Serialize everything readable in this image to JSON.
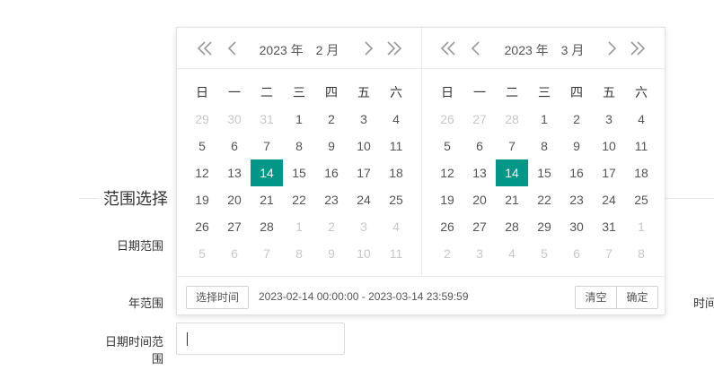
{
  "section_title": "范围选择",
  "labels": {
    "date_range": "日期范围",
    "year_range": "年范围",
    "datetime_range_line1": "日期时间范",
    "datetime_range_line2": "围",
    "side_label": "时间"
  },
  "input": {
    "value": ""
  },
  "weekdays": [
    "日",
    "一",
    "二",
    "三",
    "四",
    "五",
    "六"
  ],
  "left_calendar": {
    "year": "2023 年",
    "month": "2 月",
    "selected": 14,
    "days": [
      [
        [
          "29",
          1
        ],
        [
          "30",
          1
        ],
        [
          "31",
          1
        ],
        [
          "1",
          0
        ],
        [
          "2",
          0
        ],
        [
          "3",
          0
        ],
        [
          "4",
          0
        ]
      ],
      [
        [
          "5",
          0
        ],
        [
          "6",
          0
        ],
        [
          "7",
          0
        ],
        [
          "8",
          0
        ],
        [
          "9",
          0
        ],
        [
          "10",
          0
        ],
        [
          "11",
          0
        ]
      ],
      [
        [
          "12",
          0
        ],
        [
          "13",
          0
        ],
        [
          "14",
          0
        ],
        [
          "15",
          0
        ],
        [
          "16",
          0
        ],
        [
          "17",
          0
        ],
        [
          "18",
          0
        ]
      ],
      [
        [
          "19",
          0
        ],
        [
          "20",
          0
        ],
        [
          "21",
          0
        ],
        [
          "22",
          0
        ],
        [
          "23",
          0
        ],
        [
          "24",
          0
        ],
        [
          "25",
          0
        ]
      ],
      [
        [
          "26",
          0
        ],
        [
          "27",
          0
        ],
        [
          "28",
          0
        ],
        [
          "1",
          1
        ],
        [
          "2",
          1
        ],
        [
          "3",
          1
        ],
        [
          "4",
          1
        ]
      ],
      [
        [
          "5",
          1
        ],
        [
          "6",
          1
        ],
        [
          "7",
          1
        ],
        [
          "8",
          1
        ],
        [
          "9",
          1
        ],
        [
          "10",
          1
        ],
        [
          "11",
          1
        ]
      ]
    ]
  },
  "right_calendar": {
    "year": "2023 年",
    "month": "3 月",
    "selected": 14,
    "days": [
      [
        [
          "26",
          1
        ],
        [
          "27",
          1
        ],
        [
          "28",
          1
        ],
        [
          "1",
          0
        ],
        [
          "2",
          0
        ],
        [
          "3",
          0
        ],
        [
          "4",
          0
        ]
      ],
      [
        [
          "5",
          0
        ],
        [
          "6",
          0
        ],
        [
          "7",
          0
        ],
        [
          "8",
          0
        ],
        [
          "9",
          0
        ],
        [
          "10",
          0
        ],
        [
          "11",
          0
        ]
      ],
      [
        [
          "12",
          0
        ],
        [
          "13",
          0
        ],
        [
          "14",
          0
        ],
        [
          "15",
          0
        ],
        [
          "16",
          0
        ],
        [
          "17",
          0
        ],
        [
          "18",
          0
        ]
      ],
      [
        [
          "19",
          0
        ],
        [
          "20",
          0
        ],
        [
          "21",
          0
        ],
        [
          "22",
          0
        ],
        [
          "23",
          0
        ],
        [
          "24",
          0
        ],
        [
          "25",
          0
        ]
      ],
      [
        [
          "26",
          0
        ],
        [
          "27",
          0
        ],
        [
          "28",
          0
        ],
        [
          "29",
          0
        ],
        [
          "30",
          0
        ],
        [
          "31",
          0
        ],
        [
          "1",
          1
        ]
      ],
      [
        [
          "2",
          1
        ],
        [
          "3",
          1
        ],
        [
          "4",
          1
        ],
        [
          "5",
          1
        ],
        [
          "6",
          1
        ],
        [
          "7",
          1
        ],
        [
          "8",
          1
        ]
      ]
    ]
  },
  "footer": {
    "select_time_label": "选择时间",
    "range_text": "2023-02-14 00:00:00 - 2023-03-14 23:59:59",
    "clear_label": "清空",
    "confirm_label": "确定"
  },
  "colors": {
    "accent": "#009688",
    "muted_day": "#c8c8c8",
    "nav_arrow": "#999999"
  }
}
